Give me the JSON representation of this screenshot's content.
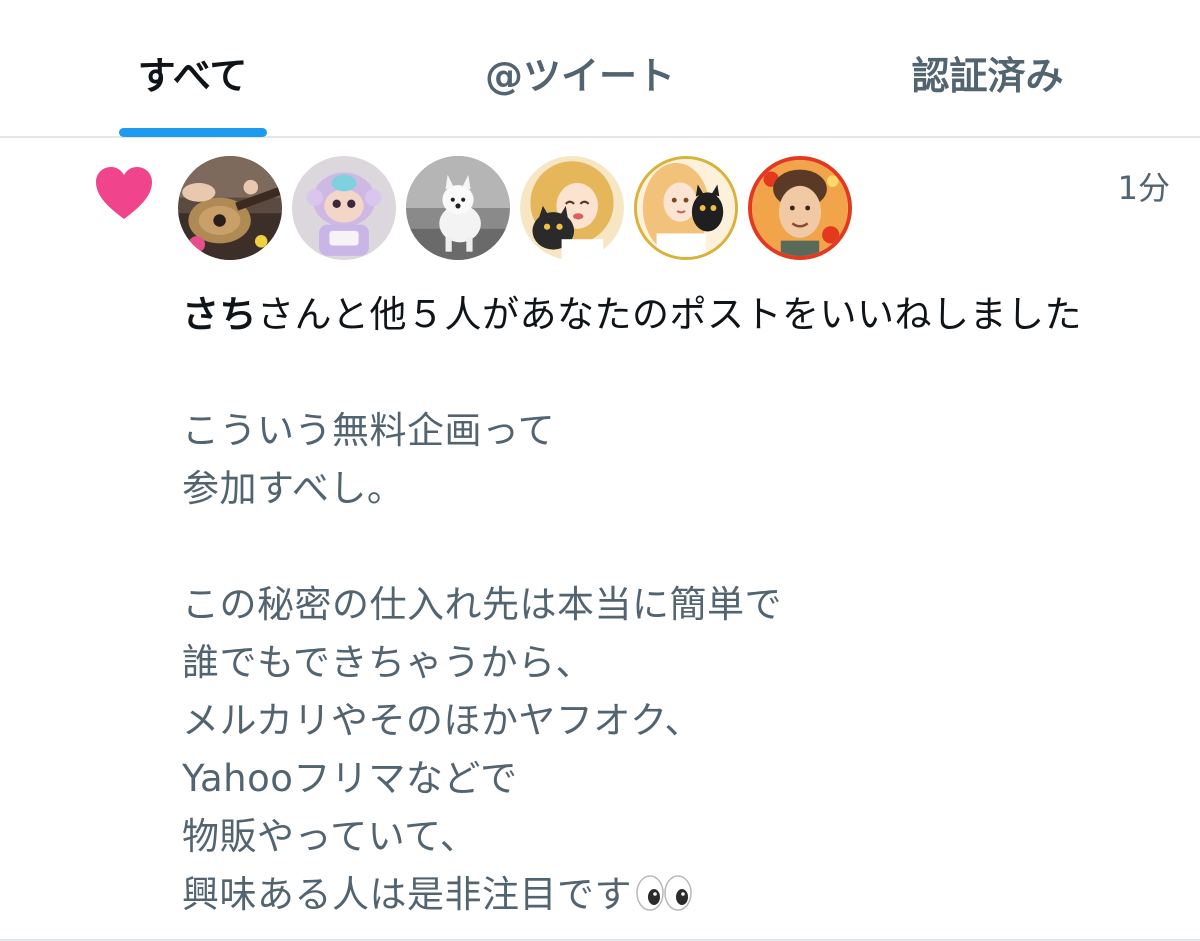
{
  "tabs": [
    {
      "label": "すべて",
      "active": true
    },
    {
      "label": "@ツイート",
      "active": false
    },
    {
      "label": "認証済み",
      "active": false
    }
  ],
  "colors": {
    "accent": "#1d9bf0",
    "like_heart": "#f0448c",
    "primary_text": "#0f1419",
    "secondary_text": "#536471",
    "divider": "#e3e6e9"
  },
  "notification": {
    "type_icon": "heart-icon",
    "timestamp": "1分",
    "liker_name": "さち",
    "summary_rest": "さんと他５人があなたのポストをいいねしました",
    "avatars": [
      {
        "icon": "avatar-guitar-photo"
      },
      {
        "icon": "avatar-plush-doll"
      },
      {
        "icon": "avatar-white-dog"
      },
      {
        "icon": "avatar-anime-girl-with-cat"
      },
      {
        "icon": "avatar-blonde-girl-with-black-cat"
      },
      {
        "icon": "avatar-illustrated-man"
      }
    ],
    "tweet_text": "こういう無料企画って\n参加すべし。\n\nこの秘密の仕入れ先は本当に簡単で\n誰でもできちゃうから、\nメルカリやそのほかヤフオク、\nYahooフリマなどで\n物販やっていて、\n興味ある人は是非注目です",
    "tweet_trailing_emoji": "eyes-emoji-icon"
  }
}
